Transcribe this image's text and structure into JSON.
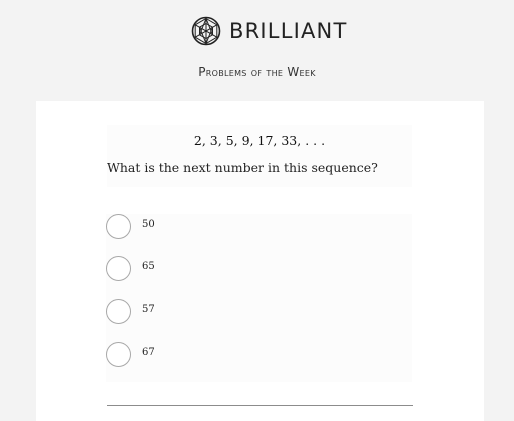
{
  "header": {
    "brand_name": "BRILLIANT",
    "subtitle": "Problems of the Week"
  },
  "problem": {
    "sequence": "2, 3, 5, 9, 17, 33, . . .",
    "question": "What is the next number in this sequence?"
  },
  "choices": [
    {
      "label": "50"
    },
    {
      "label": "65"
    },
    {
      "label": "57"
    },
    {
      "label": "67"
    }
  ],
  "colors": {
    "background": "#f3f3f3",
    "card": "#ffffff",
    "radio_border": "#a8a8a8",
    "divider": "#8c8c8c"
  }
}
